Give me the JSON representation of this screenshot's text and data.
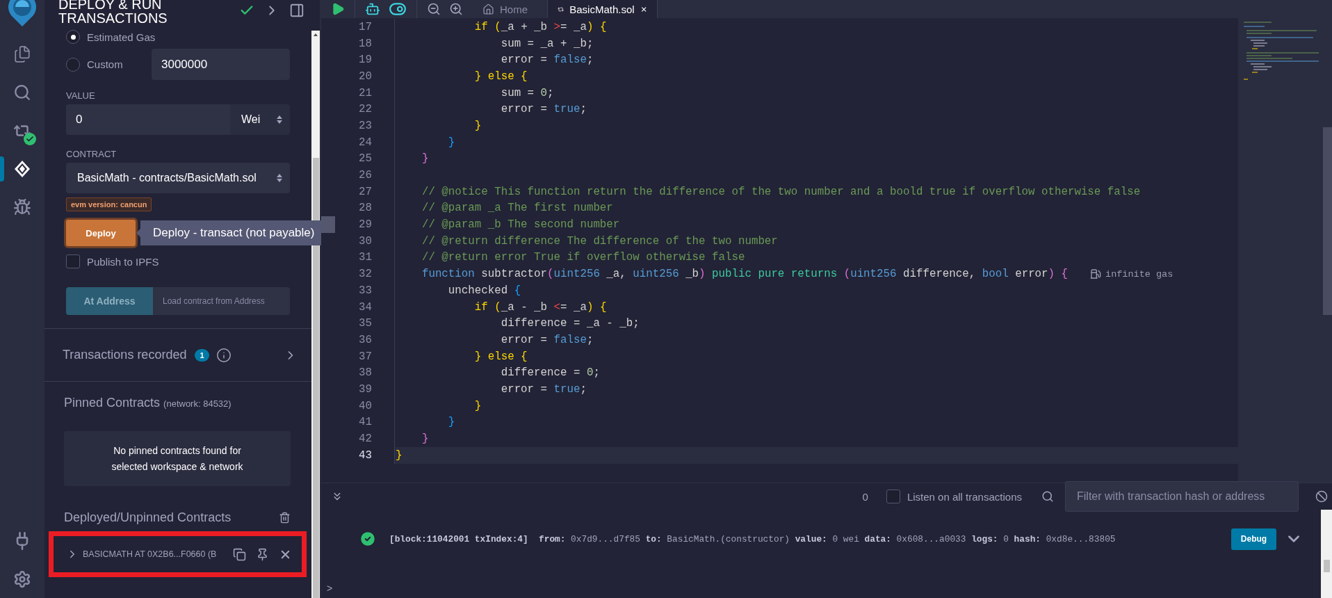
{
  "icon_bar": {
    "top": [
      {
        "kind": "files",
        "selected": false
      },
      {
        "kind": "search",
        "selected": false
      },
      {
        "kind": "compiler",
        "selected": false,
        "badge": true
      },
      {
        "kind": "deploy",
        "selected": true
      },
      {
        "kind": "debugger",
        "selected": false
      }
    ],
    "bottom": [
      {
        "kind": "plugin",
        "selected": false
      },
      {
        "kind": "settings",
        "selected": false
      }
    ]
  },
  "side_panel": {
    "title": "DEPLOY & RUN TRANSACTIONS",
    "status_ok": true,
    "gas": {
      "options": [
        {
          "label": "Estimated Gas",
          "selected": true
        },
        {
          "label": "Custom",
          "selected": false,
          "value": "3000000"
        }
      ]
    },
    "value": {
      "label": "VALUE",
      "amount": "0",
      "unit": "Wei"
    },
    "contract": {
      "label": "CONTRACT",
      "selected": "BasicMath - contracts/BasicMath.sol",
      "badge": "evm version: cancun"
    },
    "deploy": {
      "label": "Deploy",
      "tooltip": "Deploy - transact (not payable)"
    },
    "publish": {
      "label": "Publish to IPFS",
      "checked": false
    },
    "at_address": {
      "label": "At Address",
      "placeholder": "Load contract from Address",
      "disabled": true
    },
    "transactions_recorded": {
      "label": "Transactions recorded",
      "count": "1"
    },
    "pinned": {
      "title": "Pinned Contracts",
      "network": "(network: 84532)",
      "empty_message": "No pinned contracts found for selected workspace & network"
    },
    "deployed": {
      "title": "Deployed/Unpinned Contracts",
      "instances": [
        {
          "label": "BASICMATH AT 0X2B6...F0660 (B",
          "expanded": false,
          "highlighted": true
        }
      ]
    }
  },
  "editor": {
    "tabs": [
      {
        "kind": "home",
        "label": "Home",
        "selected": false
      },
      {
        "kind": "file",
        "label": "BasicMath.sol",
        "selected": true
      }
    ],
    "lines": [
      {
        "number": "17",
        "tokens": [
          {
            "text": "            if ",
            "kind": "keyword"
          },
          {
            "text": "(",
            "kind": "brace1"
          },
          {
            "text": "_a + _b ",
            "kind": "plain"
          },
          {
            "text": ">",
            "kind": "operator"
          },
          {
            "text": "= _a",
            "kind": "plain"
          },
          {
            "text": ") {",
            "kind": "brace1"
          }
        ]
      },
      {
        "number": "18",
        "tokens": [
          {
            "text": "                sum = _a + _b;",
            "kind": "plain"
          }
        ]
      },
      {
        "number": "19",
        "tokens": [
          {
            "text": "                error = ",
            "kind": "plain"
          },
          {
            "text": "false",
            "kind": "literal"
          },
          {
            "text": ";",
            "kind": "plain"
          }
        ]
      },
      {
        "number": "20",
        "tokens": [
          {
            "text": "            } else {",
            "kind": "keyword"
          }
        ]
      },
      {
        "number": "21",
        "tokens": [
          {
            "text": "                sum = ",
            "kind": "plain"
          },
          {
            "text": "0",
            "kind": "number"
          },
          {
            "text": ";",
            "kind": "plain"
          }
        ]
      },
      {
        "number": "22",
        "tokens": [
          {
            "text": "                error = ",
            "kind": "plain"
          },
          {
            "text": "true",
            "kind": "literal"
          },
          {
            "text": ";",
            "kind": "plain"
          }
        ]
      },
      {
        "number": "23",
        "tokens": [
          {
            "text": "            }",
            "kind": "brace1"
          }
        ]
      },
      {
        "number": "24",
        "tokens": [
          {
            "text": "        }",
            "kind": "brace3"
          }
        ]
      },
      {
        "number": "25",
        "tokens": [
          {
            "text": "    }",
            "kind": "brace2"
          }
        ]
      },
      {
        "number": "26"
      },
      {
        "number": "27",
        "tokens": [
          {
            "text": "    // @notice This function return the difference of the two number and a boold true if overflow otherwise false",
            "kind": "comment"
          }
        ]
      },
      {
        "number": "28",
        "tokens": [
          {
            "text": "    // @param _a The first number",
            "kind": "comment"
          }
        ]
      },
      {
        "number": "29",
        "marker": true,
        "tokens": [
          {
            "text": "    // @param _b The second number",
            "kind": "comment"
          }
        ]
      },
      {
        "number": "30",
        "tokens": [
          {
            "text": "    // @return difference The difference of the two number",
            "kind": "comment"
          }
        ]
      },
      {
        "number": "31",
        "tokens": [
          {
            "text": "    // @return error True if overflow otherwise false",
            "kind": "comment"
          }
        ]
      },
      {
        "number": "32",
        "annotation": "infinite gas",
        "tokens": [
          {
            "text": "    function",
            "kind": "type"
          },
          {
            "text": " subtractor",
            "kind": "plain"
          },
          {
            "text": "(",
            "kind": "brace2"
          },
          {
            "text": "uint256",
            "kind": "type"
          },
          {
            "text": " _a, ",
            "kind": "plain"
          },
          {
            "text": "uint256",
            "kind": "type"
          },
          {
            "text": " _b",
            "kind": "plain"
          },
          {
            "text": ")",
            "kind": "brace2"
          },
          {
            "text": " public pure returns ",
            "kind": "modifier"
          },
          {
            "text": "(",
            "kind": "brace2"
          },
          {
            "text": "uint256",
            "kind": "type"
          },
          {
            "text": " difference, ",
            "kind": "plain"
          },
          {
            "text": "bool",
            "kind": "type"
          },
          {
            "text": " error",
            "kind": "plain"
          },
          {
            "text": ") {",
            "kind": "brace2"
          }
        ]
      },
      {
        "number": "33",
        "tokens": [
          {
            "text": "        unchecked ",
            "kind": "plain"
          },
          {
            "text": "{",
            "kind": "brace3"
          }
        ]
      },
      {
        "number": "34",
        "tokens": [
          {
            "text": "            if ",
            "kind": "keyword"
          },
          {
            "text": "(",
            "kind": "brace1"
          },
          {
            "text": "_a - _b ",
            "kind": "plain"
          },
          {
            "text": "<",
            "kind": "operator"
          },
          {
            "text": "= _a",
            "kind": "plain"
          },
          {
            "text": ") {",
            "kind": "brace1"
          }
        ]
      },
      {
        "number": "35",
        "tokens": [
          {
            "text": "                difference = _a - _b;",
            "kind": "plain"
          }
        ]
      },
      {
        "number": "36",
        "tokens": [
          {
            "text": "                error = ",
            "kind": "plain"
          },
          {
            "text": "false",
            "kind": "literal"
          },
          {
            "text": ";",
            "kind": "plain"
          }
        ]
      },
      {
        "number": "37",
        "tokens": [
          {
            "text": "            } else {",
            "kind": "keyword"
          }
        ]
      },
      {
        "number": "38",
        "tokens": [
          {
            "text": "                difference = ",
            "kind": "plain"
          },
          {
            "text": "0",
            "kind": "number"
          },
          {
            "text": ";",
            "kind": "plain"
          }
        ]
      },
      {
        "number": "39",
        "tokens": [
          {
            "text": "                error = ",
            "kind": "plain"
          },
          {
            "text": "true",
            "kind": "literal"
          },
          {
            "text": ";",
            "kind": "plain"
          }
        ]
      },
      {
        "number": "40",
        "tokens": [
          {
            "text": "            }",
            "kind": "brace1"
          }
        ]
      },
      {
        "number": "41",
        "tokens": [
          {
            "text": "        }",
            "kind": "brace3"
          }
        ]
      },
      {
        "number": "42",
        "tokens": [
          {
            "text": "    }",
            "kind": "brace2"
          }
        ]
      },
      {
        "number": "43",
        "current": true,
        "tokens": [
          {
            "text": "}",
            "kind": "brace1"
          }
        ]
      }
    ]
  },
  "terminal": {
    "count": "0",
    "listen": {
      "label": "Listen on all transactions",
      "checked": false
    },
    "filter_placeholder": "Filter with transaction hash or address",
    "logs": [
      {
        "success": true,
        "header": "[block:11042001 txIndex:4]",
        "fields": [
          {
            "label": "from:",
            "value": "0x7d9...d7f85"
          },
          {
            "label": "to:",
            "value": "BasicMath.(constructor)"
          },
          {
            "label": "value:",
            "value": "0 wei"
          },
          {
            "label": "data:",
            "value": "0x608...a0033"
          },
          {
            "label": "logs:",
            "value": "0"
          },
          {
            "label": "hash:",
            "value": "0xd8e...83805"
          }
        ],
        "button": "Debug",
        "expanded": false
      }
    ],
    "prompt": ">"
  }
}
